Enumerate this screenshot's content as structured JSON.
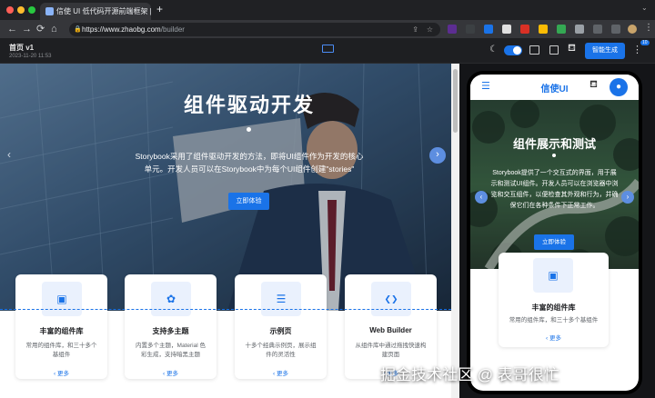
{
  "browser": {
    "tab_title": "信使 UI 低代码开源前端框架 | X",
    "new_tab": "+",
    "url_host": "https://www.zhaobg.com",
    "url_path": "/builder",
    "nav": {
      "back": "←",
      "forward": "→",
      "reload": "⟳",
      "home": "⌂"
    },
    "window_dot_colors": [
      "#ff5f57",
      "#febc2e",
      "#28c840"
    ]
  },
  "app": {
    "page_title": "首页 v1",
    "page_date": "2023-11-20 11:53",
    "generate_label": "智能生成",
    "badge": "10"
  },
  "hero": {
    "title": "组件驱动开发",
    "desc_line1": "Storybook采用了组件驱动开发的方法，即将UI组件作为开发的核心",
    "desc_line2": "单元。开发人员可以在Storybook中为每个UI组件创建\"stories\"",
    "cta": "立即体验"
  },
  "cards": [
    {
      "icon": "grid-icon",
      "glyph": "▣",
      "title": "丰富的组件库",
      "desc": [
        "常用的组件库，和三十多个",
        "基组件"
      ],
      "more": "更多"
    },
    {
      "icon": "palette-icon",
      "glyph": "✿",
      "title": "支持多主题",
      "desc": [
        "内置多个主题，Material 色",
        "彩生成，支持暗黑主题"
      ],
      "more": "更多"
    },
    {
      "icon": "list-icon",
      "glyph": "☰",
      "title": "示例页",
      "desc": [
        "十多个经典示例页，展示组",
        "件的灵活性"
      ],
      "more": "更多"
    },
    {
      "icon": "vscode-icon",
      "glyph": "❮❯",
      "title": "Web Builder",
      "desc": [
        "从组件库中通过拖拽快速构",
        "建页面"
      ],
      "more": "更多"
    }
  ],
  "mobile": {
    "brand": "信使UI",
    "title": "组件展示和测试",
    "desc": [
      "Storybook提供了一个交互式的界面，用于展",
      "示和测试UI组件。开发人员可以在浏览器中浏",
      "览和交互组件，以便检查其外观和行为，并确",
      "保它们在各种条件下正常工作。"
    ],
    "cta": "立即体验",
    "card": {
      "title": "丰富的组件库",
      "desc": "常用的组件库，和三十多个基组件",
      "more": "更多"
    }
  },
  "watermark": "掘金技术社区 @ 表哥很忙",
  "colors": {
    "accent": "#1a73e8",
    "page": "#202124"
  }
}
